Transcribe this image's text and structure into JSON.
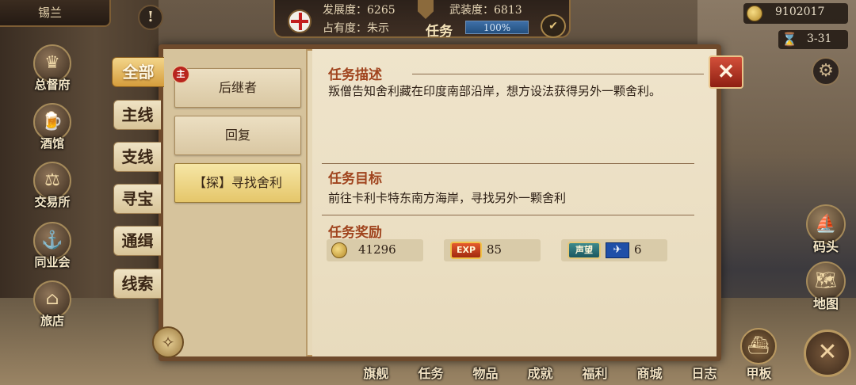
{
  "city": {
    "name": "锡兰"
  },
  "stats": {
    "development": "发展度：6265",
    "military": "武装度：6813",
    "occupancy_label": "占有度：朱示",
    "occupancy_percent": "100%",
    "occupancy_fraction": 1.0
  },
  "window_title": "任务",
  "resources": {
    "gold": "9102017",
    "date": "3-31"
  },
  "left_nav": [
    {
      "label": "总督府",
      "icon": "crown-icon"
    },
    {
      "label": "酒馆",
      "icon": "tavern-icon"
    },
    {
      "label": "交易所",
      "icon": "scales-icon"
    },
    {
      "label": "同业会",
      "icon": "anchor-icon"
    },
    {
      "label": "旅店",
      "icon": "inn-icon"
    }
  ],
  "right_nav": [
    {
      "label": "码头",
      "icon": "dock-icon"
    },
    {
      "label": "地图",
      "icon": "map-icon"
    }
  ],
  "bottom_nav": [
    "旗舰",
    "任务",
    "物品",
    "成就",
    "福利",
    "商城",
    "日志",
    "甲板"
  ],
  "categories": [
    "全部",
    "主线",
    "支线",
    "寻宝",
    "通缉",
    "线索"
  ],
  "active_category": "全部",
  "quests": [
    {
      "title": "后继者",
      "badge": "主"
    },
    {
      "title": "回复",
      "badge": ""
    },
    {
      "title": "【探】寻找舍利",
      "badge": ""
    }
  ],
  "detail": {
    "desc_heading": "任务描述",
    "desc_text": "叛僧告知舍利藏在印度南部沿岸，想方设法获得另外一颗舍利。",
    "goal_heading": "任务目标",
    "goal_text": "前往卡利卡特东南方海岸，寻找另外一颗舍利",
    "reward_heading": "任务奖励",
    "rewards": {
      "gold": "41296",
      "exp_label": "EXP",
      "exp": "85",
      "reputation_label": "声望",
      "reputation": "6"
    }
  },
  "colors": {
    "accent_red": "#a0441e",
    "tab_active": "#d59d3c",
    "parchment": "#efe4cb"
  }
}
